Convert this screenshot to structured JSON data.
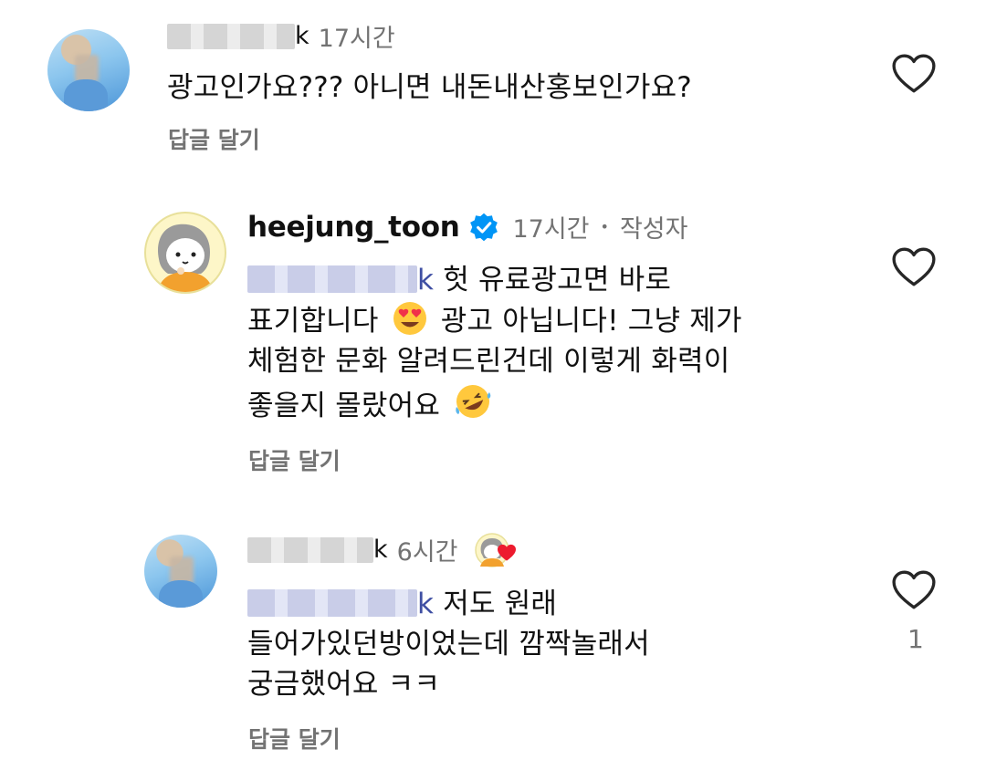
{
  "comments": [
    {
      "username": "",
      "username_tail": "k",
      "time": "17시간",
      "text": "광고인가요??? 아니면 내돈내산홍보인가요?",
      "reply_label": "답글 달기"
    },
    {
      "username": "heejung_toon",
      "verified": true,
      "time": "17시간",
      "separator": "•",
      "author_badge": "작성자",
      "mention_tail": "k",
      "lines": [
        "헛 유료광고면 바로",
        "표기합니다",
        "광고 아닙니다! 그냥 제가",
        "체험한 문화 알려드린건데 이렇게 화력이",
        "좋을지 몰랐어요"
      ],
      "emojis": [
        "heart-eyes-emoji",
        "rofl-emoji"
      ],
      "reply_label": "답글 달기"
    },
    {
      "username": "",
      "username_tail": "k",
      "time": "6시간",
      "liked_by_author": true,
      "mention_tail": "k",
      "lines": [
        "저도 원래",
        "들어가있던방이었는데 깜짝놀래서",
        "궁금했어요 ㅋㅋ"
      ],
      "reply_label": "답글 달기",
      "like_count": "1"
    }
  ],
  "colors": {
    "accent_blue": "#0095f6",
    "muted": "#737373",
    "like_red": "#ed1b2e"
  }
}
